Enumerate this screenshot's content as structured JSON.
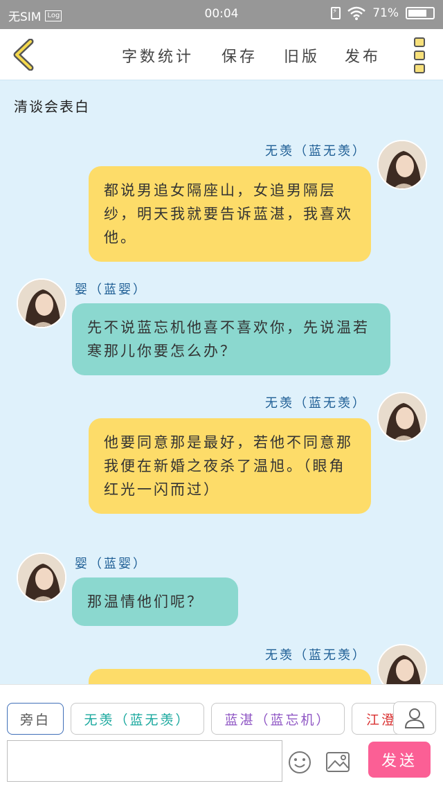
{
  "status_bar": {
    "carrier": "无SIM",
    "log_badge": "Log",
    "time": "00:04",
    "battery_percent": "71%",
    "battery_level": 0.71
  },
  "toolbar": {
    "back_icon": "chevron-left-icon",
    "word_count": "字数统计",
    "save": "保存",
    "old_version": "旧版",
    "publish": "发布",
    "menu_icon": "more-vertical-icon"
  },
  "chat": {
    "scene_title": "清谈会表白",
    "messages": [
      {
        "speaker": "无羡（蓝无羡）",
        "side": "right",
        "color": "#fddc69",
        "text": "都说男追女隔座山，女追男隔层纱，明天我就要告诉蓝湛，我喜欢他。"
      },
      {
        "speaker": "婴（蓝婴）",
        "side": "left",
        "color": "#8bd8cf",
        "text": "先不说蓝忘机他喜不喜欢你，先说温若寒那儿你要怎么办？"
      },
      {
        "speaker": "无羡（蓝无羡）",
        "side": "right",
        "color": "#fddc69",
        "text": "他要同意那是最好，若他不同意那我便在新婚之夜杀了温旭。（眼角红光一闪而过）"
      },
      {
        "speaker": "婴（蓝婴）",
        "side": "left",
        "color": "#8bd8cf",
        "text": "那温情他们呢？"
      },
      {
        "speaker": "无羡（蓝无羡）",
        "side": "right",
        "color": "#fddc69",
        "text": ""
      }
    ]
  },
  "bottom": {
    "roles": [
      "旁白",
      "无羡（蓝无羡）",
      "蓝湛（蓝忘机）",
      "江澄"
    ],
    "role_button_icon": "person-icon",
    "input_placeholder": "",
    "emoji_icon": "smile-icon",
    "image_icon": "image-icon",
    "send": "发送"
  }
}
